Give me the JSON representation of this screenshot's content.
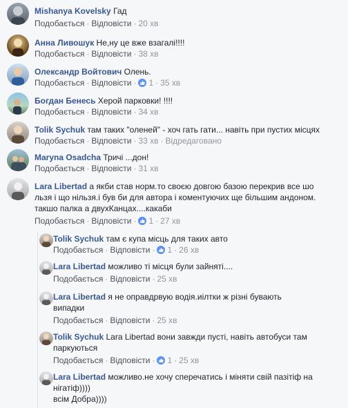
{
  "actions": {
    "like": "Подобається",
    "reply": "Відповісти",
    "edited": "Відредаговано"
  },
  "comments": [
    {
      "author": "Mishanya Kovelsky",
      "text": "Гад",
      "time": "20 хв"
    },
    {
      "author": "Анна Ливошук",
      "text": "Не,ну це вже взагалі!!!!",
      "time": "38 хв"
    },
    {
      "author": "Олександр Войтович",
      "text": "Олень.",
      "likes": "1",
      "time": "35 хв"
    },
    {
      "author": "Богдан Бенесь",
      "text": "Херой парковки! !!!!",
      "time": "34 хв"
    },
    {
      "author": "Tolik Sychuk",
      "text": "там таких \"оленей\" - хоч гать гати... навіть при пустих місцях",
      "time": "33 хв"
    },
    {
      "author": "Maryna Osadcha",
      "text": "Тричі ...дон!",
      "time": "31 хв"
    },
    {
      "author": "Lara Libertad",
      "text": "а якби став норм.то своєю довгою базою перекрив все шо льзя і що нільзя.і був би для автора і коментуючих ще більшим андоном. такшо палка а двухКанцах....какаби",
      "likes": "1",
      "time": "27 хв"
    }
  ],
  "replies": [
    {
      "author": "Tolik Sychuk",
      "text": "там є купа місць для таких авто",
      "likes": "1",
      "time": "26 хв"
    },
    {
      "author": "Lara Libertad",
      "text": "можливо ті місця були зайняті....",
      "time": "25 хв"
    },
    {
      "author": "Lara Libertad",
      "text": "я не оправдрвую водія.иілтки ж різні бувають випадки",
      "time": "25 хв"
    },
    {
      "author": "Tolik Sychuk",
      "text": "Lara Libertad вони завжди пусті, навіть автобуси там паркуються",
      "likes": "1",
      "time": "25 хв"
    },
    {
      "author": "Lara Libertad",
      "text": "можливо.не хочу сперечатись і міняти свій пазітіф на нігатіф))))\nвсім Добра))))"
    }
  ],
  "colors": {
    "link": "#385898",
    "meta": "#90949c",
    "like_badge": "#5890ff"
  },
  "icons": {
    "like": "thumbs-up-icon"
  }
}
